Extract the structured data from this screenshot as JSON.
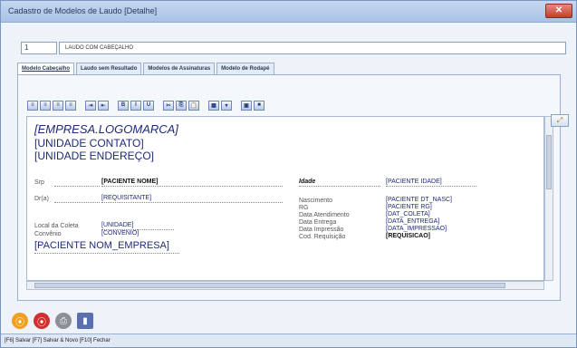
{
  "window": {
    "title": "Cadastro de Modelos de Laudo [Detalhe]",
    "close_label": "✕"
  },
  "record": {
    "code": "1",
    "description": "LAUDO COM CABEÇALHO"
  },
  "tabs": [
    {
      "label": "Modelo Cabeçalho",
      "active": true
    },
    {
      "label": "Laudo sem Resultado",
      "active": false
    },
    {
      "label": "Modelos de Assinaturas",
      "active": false
    },
    {
      "label": "Modelo de Rodapé",
      "active": false
    }
  ],
  "toolbar": {
    "buttons": [
      {
        "name": "align-left-icon",
        "glyph": "≡"
      },
      {
        "name": "align-center-icon",
        "glyph": "≡"
      },
      {
        "name": "align-right-icon",
        "glyph": "≡"
      },
      {
        "name": "justify-icon",
        "glyph": "≡"
      },
      {
        "name": "indent-icon",
        "glyph": "⇥"
      },
      {
        "name": "outdent-icon",
        "glyph": "⇤"
      },
      {
        "name": "bold-icon",
        "glyph": "B"
      },
      {
        "name": "italic-icon",
        "glyph": "I"
      },
      {
        "name": "underline-icon",
        "glyph": "U"
      },
      {
        "name": "cut-icon",
        "glyph": "✂"
      },
      {
        "name": "copy-icon",
        "glyph": "⎘"
      },
      {
        "name": "paste-icon",
        "glyph": "📋"
      },
      {
        "name": "table-icon",
        "glyph": "▦"
      },
      {
        "name": "dropdown-icon",
        "glyph": "▾"
      },
      {
        "name": "image-icon",
        "glyph": "▣"
      },
      {
        "name": "insert-icon",
        "glyph": "■"
      }
    ]
  },
  "editor": {
    "logo": "[EMPRESA.LOGOMARCA]",
    "contato": "[UNIDADE CONTATO]",
    "endereco": "[UNIDADE ENDEREÇO]",
    "row1": {
      "label": "Srp",
      "value": "[PACIENTE NOME]",
      "label2": "Idade",
      "value2": "[PACIENTE IDADE]"
    },
    "row2": {
      "label": "Dr(a)",
      "value": "[REQUISITANTE]"
    },
    "right_fields": [
      {
        "label": "Nascimento",
        "value": "[PACIENTE DT_NASC]"
      },
      {
        "label": "RG",
        "value": "[PACIENTE RG]"
      },
      {
        "label": "Data Atendimento",
        "value": "[DAT_COLETA]"
      },
      {
        "label": "Data Entrega",
        "value": "[DATA_ENTREGA]"
      },
      {
        "label": "Data Impressão",
        "value": "[DATA_IMPRESSAO]"
      },
      {
        "label": "Cod. Requisição",
        "value": "[REQUISICAO]"
      }
    ],
    "local_label": "Local da Coleta",
    "local_value": "[UNIDADE]",
    "convenio_label": "Convênio",
    "convenio_value": "[CONVENIO]",
    "empresa": "[PACIENTE NOM_EMPRESA]"
  },
  "side_button": "⤢",
  "bottom_icons": [
    {
      "name": "save-icon",
      "glyph": "⦿",
      "color": "#f0a020"
    },
    {
      "name": "cancel-icon",
      "glyph": "⦿",
      "color": "#d03030"
    },
    {
      "name": "print-icon",
      "glyph": "⎙",
      "color": "#8a8f99"
    },
    {
      "name": "exit-icon",
      "glyph": "▮",
      "color": "#5a6fb0"
    }
  ],
  "status": "[F6] Salvar [F7] Salvar & Novo [F10] Fechar"
}
